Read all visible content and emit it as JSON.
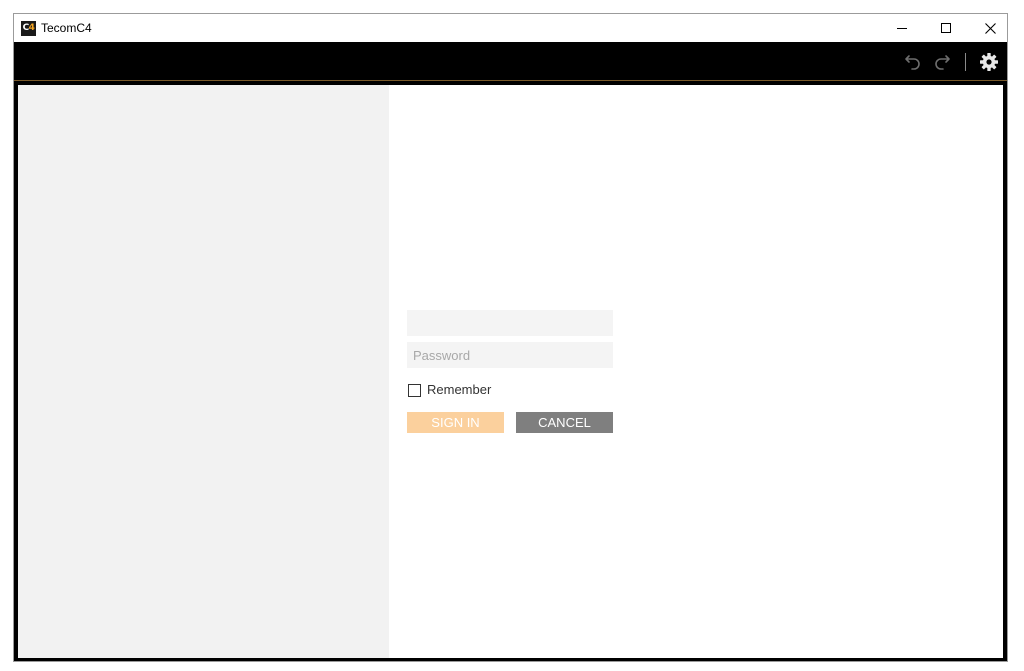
{
  "window": {
    "title": "TecomC4",
    "logo_text_primary": "C",
    "logo_text_accent": "4"
  },
  "toolbar": {
    "undo_icon": "undo-icon",
    "redo_icon": "redo-icon",
    "settings_icon": "gear-icon"
  },
  "login": {
    "username_value": "",
    "username_placeholder": "",
    "password_value": "",
    "password_placeholder": "Password",
    "remember_label": "Remember",
    "remember_checked": false,
    "signin_label": "SIGN IN",
    "cancel_label": "CANCEL"
  },
  "colors": {
    "toolbar_bg": "#000000",
    "left_pane_bg": "#f2f2f2",
    "signin_bg": "#fbd09d",
    "cancel_bg": "#7f7f7f",
    "logo_accent": "#f5a623"
  }
}
